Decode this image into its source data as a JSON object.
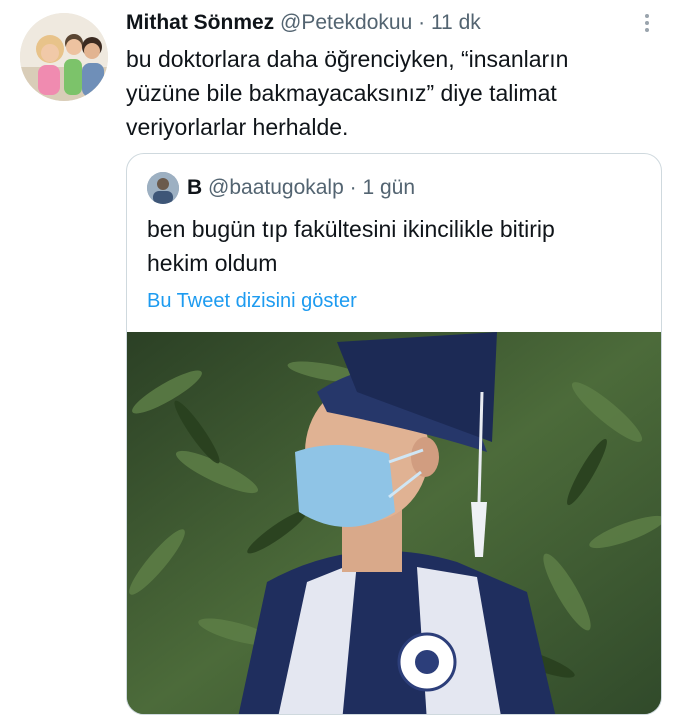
{
  "tweet": {
    "author_name": "Mithat Sönmez",
    "handle": "@Petekdokuu",
    "separator": "·",
    "time": "11 dk",
    "text_lines": [
      "bu doktorlara daha öğrenciyken, “insanların",
      "yüzüne bile bakmayacaksınız” diye talimat",
      "veriyorlarlar herhalde."
    ],
    "more_icon": "more-vertical-icon"
  },
  "quoted": {
    "author_name": "B",
    "handle": "@baatugokalp",
    "separator": "·",
    "time": "1 gün",
    "text_lines": [
      "ben bugün tıp fakültesini ikincilikle bitirip",
      "hekim oldum"
    ],
    "thread_link": "Bu Tweet dizisini göster",
    "photo_description_colors": {
      "foliage": "#3d5a32",
      "cap": "#26376a",
      "mask": "#8fc4e6",
      "stole": "#e6e8f2"
    }
  },
  "colors": {
    "text": "#0f1419",
    "muted": "#536471",
    "link": "#1d9bf0",
    "border": "#cfd9de"
  }
}
